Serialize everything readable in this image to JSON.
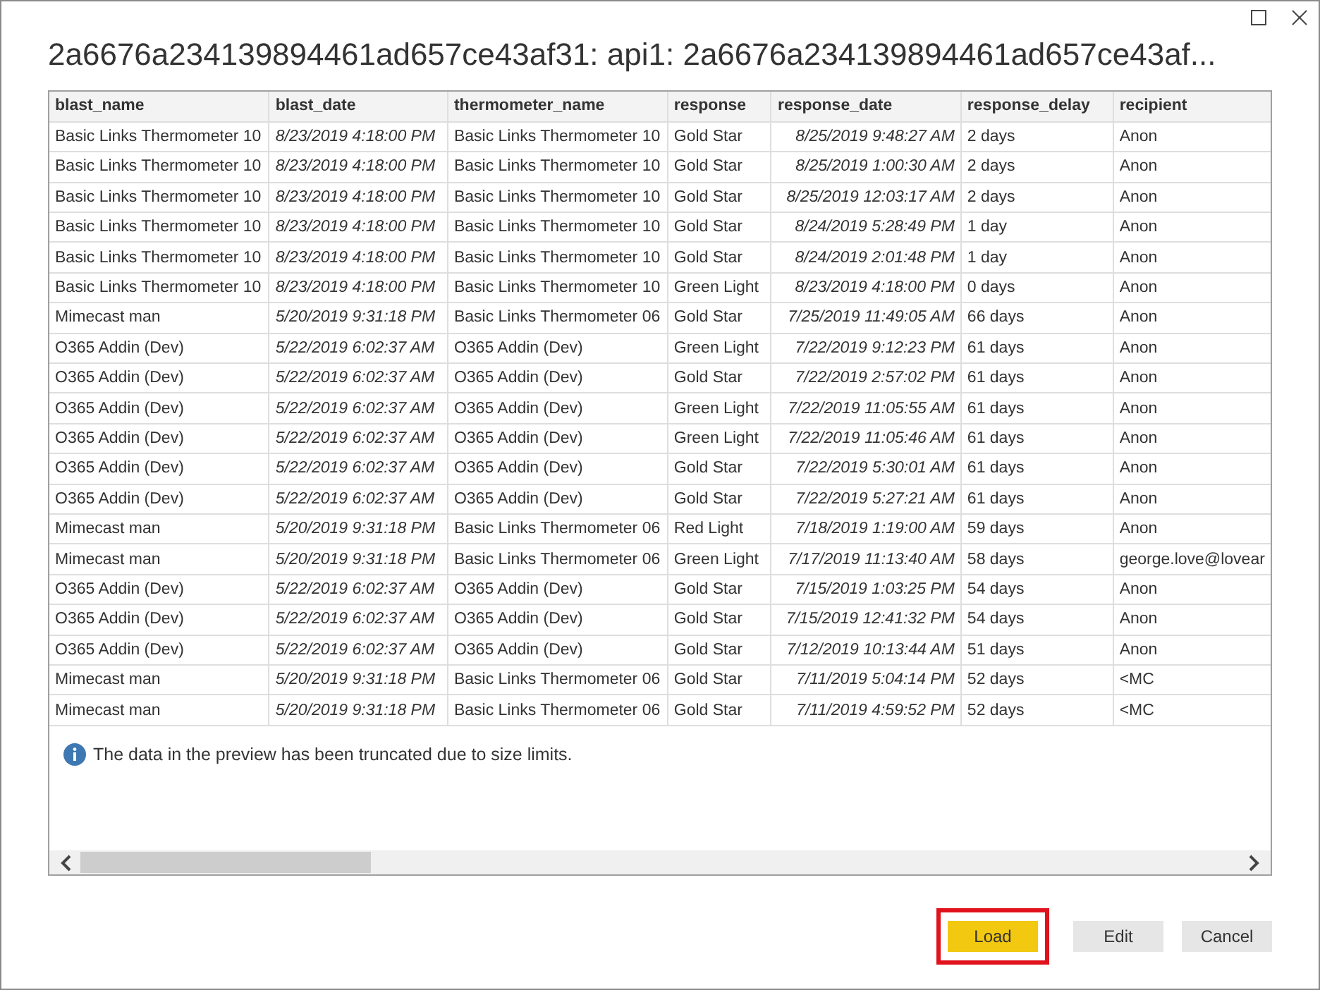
{
  "window": {
    "title": "2a6676a234139894461ad657ce43af31: api1: 2a6676a234139894461ad657ce43af..."
  },
  "table": {
    "columns": [
      {
        "label": "blast_name",
        "kind": "text"
      },
      {
        "label": "blast_date",
        "kind": "date"
      },
      {
        "label": "thermometer_name",
        "kind": "text"
      },
      {
        "label": "response",
        "kind": "text"
      },
      {
        "label": "response_date",
        "kind": "date"
      },
      {
        "label": "response_delay",
        "kind": "text"
      },
      {
        "label": "recipient",
        "kind": "text"
      }
    ],
    "rows": [
      [
        "Basic Links Thermometer 10",
        "8/23/2019 4:18:00 PM",
        "Basic Links Thermometer 10",
        "Gold Star",
        "8/25/2019 9:48:27 AM",
        "2 days",
        "Anon"
      ],
      [
        "Basic Links Thermometer 10",
        "8/23/2019 4:18:00 PM",
        "Basic Links Thermometer 10",
        "Gold Star",
        "8/25/2019 1:00:30 AM",
        "2 days",
        "Anon"
      ],
      [
        "Basic Links Thermometer 10",
        "8/23/2019 4:18:00 PM",
        "Basic Links Thermometer 10",
        "Gold Star",
        "8/25/2019 12:03:17 AM",
        "2 days",
        "Anon"
      ],
      [
        "Basic Links Thermometer 10",
        "8/23/2019 4:18:00 PM",
        "Basic Links Thermometer 10",
        "Gold Star",
        "8/24/2019 5:28:49 PM",
        "1 day",
        "Anon"
      ],
      [
        "Basic Links Thermometer 10",
        "8/23/2019 4:18:00 PM",
        "Basic Links Thermometer 10",
        "Gold Star",
        "8/24/2019 2:01:48 PM",
        "1 day",
        "Anon"
      ],
      [
        "Basic Links Thermometer 10",
        "8/23/2019 4:18:00 PM",
        "Basic Links Thermometer 10",
        "Green Light",
        "8/23/2019 4:18:00 PM",
        "0 days",
        "Anon"
      ],
      [
        "Mimecast man",
        "5/20/2019 9:31:18 PM",
        "Basic Links Thermometer 06",
        "Gold Star",
        "7/25/2019 11:49:05 AM",
        "66 days",
        "Anon"
      ],
      [
        "O365 Addin (Dev)",
        "5/22/2019 6:02:37 AM",
        "O365 Addin (Dev)",
        "Green Light",
        "7/22/2019 9:12:23 PM",
        "61 days",
        "Anon"
      ],
      [
        "O365 Addin (Dev)",
        "5/22/2019 6:02:37 AM",
        "O365 Addin (Dev)",
        "Gold Star",
        "7/22/2019 2:57:02 PM",
        "61 days",
        "Anon"
      ],
      [
        "O365 Addin (Dev)",
        "5/22/2019 6:02:37 AM",
        "O365 Addin (Dev)",
        "Green Light",
        "7/22/2019 11:05:55 AM",
        "61 days",
        "Anon"
      ],
      [
        "O365 Addin (Dev)",
        "5/22/2019 6:02:37 AM",
        "O365 Addin (Dev)",
        "Green Light",
        "7/22/2019 11:05:46 AM",
        "61 days",
        "Anon"
      ],
      [
        "O365 Addin (Dev)",
        "5/22/2019 6:02:37 AM",
        "O365 Addin (Dev)",
        "Gold Star",
        "7/22/2019 5:30:01 AM",
        "61 days",
        "Anon"
      ],
      [
        "O365 Addin (Dev)",
        "5/22/2019 6:02:37 AM",
        "O365 Addin (Dev)",
        "Gold Star",
        "7/22/2019 5:27:21 AM",
        "61 days",
        "Anon"
      ],
      [
        "Mimecast man",
        "5/20/2019 9:31:18 PM",
        "Basic Links Thermometer 06",
        "Red Light",
        "7/18/2019 1:19:00 AM",
        "59 days",
        "Anon"
      ],
      [
        "Mimecast man",
        "5/20/2019 9:31:18 PM",
        "Basic Links Thermometer 06",
        "Green Light",
        "7/17/2019 11:13:40 AM",
        "58 days",
        "george.love@lovear"
      ],
      [
        "O365 Addin (Dev)",
        "5/22/2019 6:02:37 AM",
        "O365 Addin (Dev)",
        "Gold Star",
        "7/15/2019 1:03:25 PM",
        "54 days",
        "Anon"
      ],
      [
        "O365 Addin (Dev)",
        "5/22/2019 6:02:37 AM",
        "O365 Addin (Dev)",
        "Gold Star",
        "7/15/2019 12:41:32 PM",
        "54 days",
        "Anon"
      ],
      [
        "O365 Addin (Dev)",
        "5/22/2019 6:02:37 AM",
        "O365 Addin (Dev)",
        "Gold Star",
        "7/12/2019 10:13:44 AM",
        "51 days",
        "Anon"
      ],
      [
        "Mimecast man",
        "5/20/2019 9:31:18 PM",
        "Basic Links Thermometer 06",
        "Gold Star",
        "7/11/2019 5:04:14 PM",
        "52 days",
        "<MC"
      ],
      [
        "Mimecast man",
        "5/20/2019 9:31:18 PM",
        "Basic Links Thermometer 06",
        "Gold Star",
        "7/11/2019 4:59:52 PM",
        "52 days",
        "<MC"
      ]
    ]
  },
  "notice": "The data in the preview has been truncated due to size limits.",
  "buttons": [
    {
      "label": "Load",
      "kind": "primary",
      "highlighted": true
    },
    {
      "label": "Edit",
      "kind": "secondary",
      "highlighted": false
    },
    {
      "label": "Cancel",
      "kind": "secondary",
      "highlighted": false
    }
  ]
}
